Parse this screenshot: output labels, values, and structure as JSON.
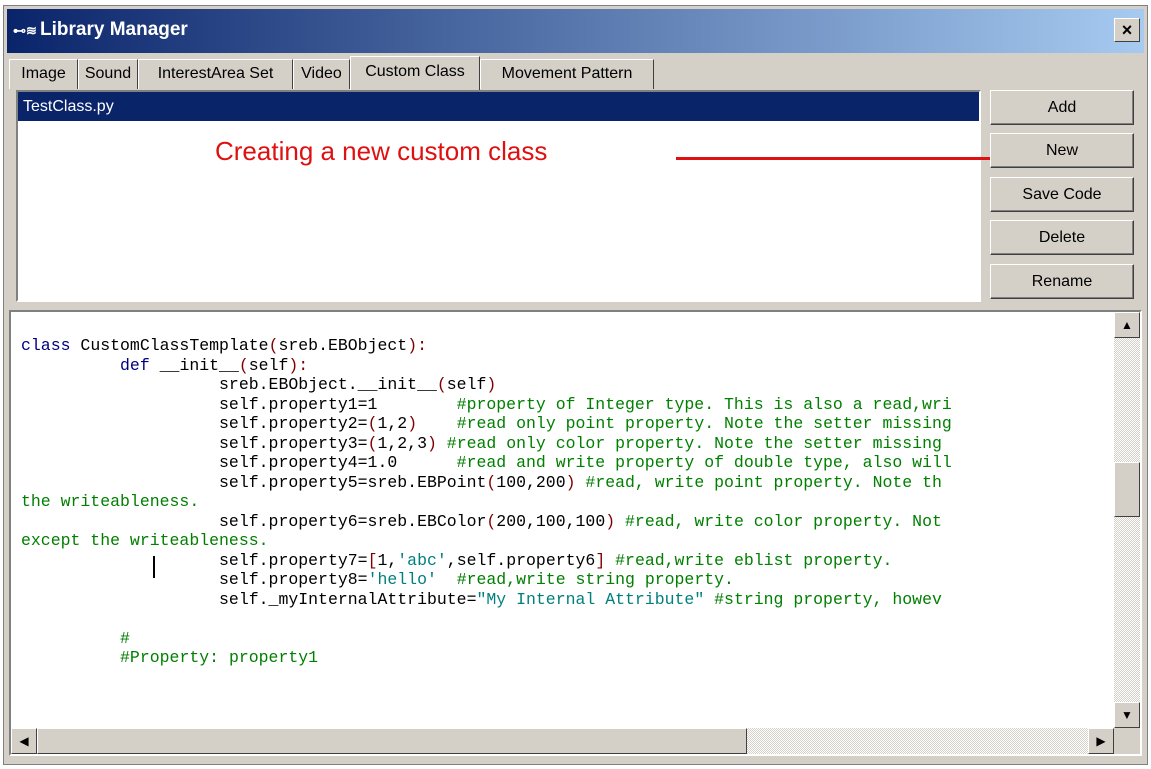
{
  "window": {
    "title": "Library Manager",
    "icon_glyph": "⊷≋",
    "close_label": "×"
  },
  "tabs": [
    {
      "label": "Image",
      "active": false
    },
    {
      "label": "Sound",
      "active": false
    },
    {
      "label": "InterestArea Set",
      "active": false
    },
    {
      "label": "Video",
      "active": false
    },
    {
      "label": "Custom Class",
      "active": true
    },
    {
      "label": "Movement Pattern",
      "active": false
    }
  ],
  "file_list": {
    "items": [
      "TestClass.py"
    ],
    "selected": "TestClass.py"
  },
  "annotation": {
    "text": "Creating a new custom class",
    "color": "#e01010"
  },
  "buttons": {
    "add": "Add",
    "new": "New",
    "save_code": "Save Code",
    "delete": "Delete",
    "rename": "Rename"
  },
  "scrollbars": {
    "up": "▲",
    "down": "▼",
    "left": "◀",
    "right": "▶"
  },
  "colors": {
    "selection": "#0a246a",
    "keyword": "#00007f",
    "punctuation": "#7f0000",
    "comment": "#007f00",
    "string": "#007f7f"
  },
  "code": [
    [
      [
        "k",
        "class"
      ],
      [
        "t",
        " CustomClassTemplate"
      ],
      [
        "p",
        "("
      ],
      [
        "t",
        "sreb.EBObject"
      ],
      [
        "p",
        "):"
      ]
    ],
    [
      [
        "t",
        "          "
      ],
      [
        "k",
        "def"
      ],
      [
        "t",
        " __init__"
      ],
      [
        "p",
        "("
      ],
      [
        "t",
        "self"
      ],
      [
        "p",
        "):"
      ]
    ],
    [
      [
        "t",
        "                    sreb.EBObject.__init__"
      ],
      [
        "p",
        "("
      ],
      [
        "t",
        "self"
      ],
      [
        "p",
        ")"
      ]
    ],
    [
      [
        "t",
        "                    self.property1=1        "
      ],
      [
        "c",
        "#property of Integer type. This is also a read,wri"
      ]
    ],
    [
      [
        "t",
        "                    self.property2="
      ],
      [
        "p",
        "("
      ],
      [
        "t",
        "1,2"
      ],
      [
        "p",
        ")"
      ],
      [
        "t",
        "    "
      ],
      [
        "c",
        "#read only point property. Note the setter missing"
      ]
    ],
    [
      [
        "t",
        "                    self.property3="
      ],
      [
        "p",
        "("
      ],
      [
        "t",
        "1,2,3"
      ],
      [
        "p",
        ")"
      ],
      [
        "t",
        " "
      ],
      [
        "c",
        "#read only color property. Note the setter missing"
      ]
    ],
    [
      [
        "t",
        "                    self.property4=1.0      "
      ],
      [
        "c",
        "#read and write property of double type, also will"
      ]
    ],
    [
      [
        "t",
        "                    self.property5=sreb.EBPoint"
      ],
      [
        "p",
        "("
      ],
      [
        "t",
        "100,200"
      ],
      [
        "p",
        ")"
      ],
      [
        "t",
        " "
      ],
      [
        "c",
        "#read, write point property. Note th"
      ]
    ],
    [
      [
        "c",
        "the writeableness."
      ]
    ],
    [
      [
        "t",
        "                    self.property6=sreb.EBColor"
      ],
      [
        "p",
        "("
      ],
      [
        "t",
        "200,100,100"
      ],
      [
        "p",
        ")"
      ],
      [
        "t",
        " "
      ],
      [
        "c",
        "#read, write color property. Not"
      ]
    ],
    [
      [
        "c",
        "except the writeableness."
      ]
    ],
    [
      [
        "t",
        "                    self.property7="
      ],
      [
        "p",
        "["
      ],
      [
        "t",
        "1,"
      ],
      [
        "s",
        "'abc'"
      ],
      [
        "t",
        ",self.property6"
      ],
      [
        "p",
        "]"
      ],
      [
        "t",
        " "
      ],
      [
        "c",
        "#read,write eblist property."
      ]
    ],
    [
      [
        "t",
        "                    self.property8="
      ],
      [
        "s",
        "'hello'"
      ],
      [
        "t",
        "  "
      ],
      [
        "c",
        "#read,write string property."
      ]
    ],
    [
      [
        "t",
        "                    self._myInternalAttribute="
      ],
      [
        "s",
        "\"My Internal Attribute\""
      ],
      [
        "t",
        " "
      ],
      [
        "c",
        "#string property, howev"
      ]
    ],
    [
      [
        "t",
        ""
      ]
    ],
    [
      [
        "t",
        "          "
      ],
      [
        "c",
        "#"
      ]
    ],
    [
      [
        "t",
        "          "
      ],
      [
        "c",
        "#Property: property1"
      ]
    ]
  ]
}
